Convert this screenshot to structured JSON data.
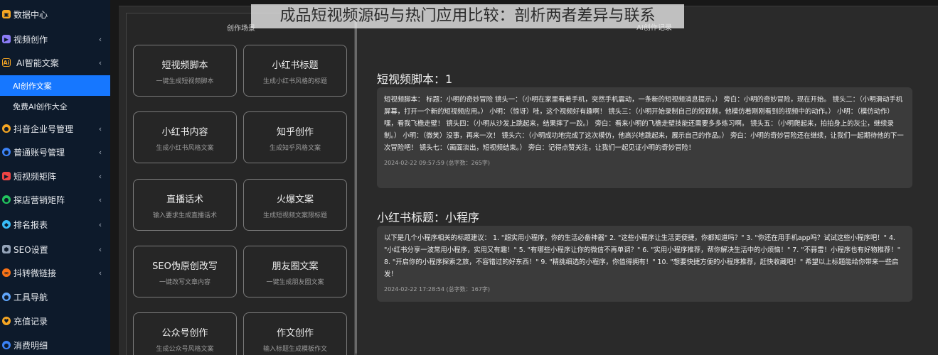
{
  "sidebar": {
    "items": [
      {
        "label": "数据中心",
        "icon": "data-center-icon",
        "color": "#f5a623"
      },
      {
        "label": "视频创作",
        "icon": "video-icon",
        "color": "#8b7cf6",
        "chevron": "‹"
      },
      {
        "label": "AI智能文案",
        "icon": "ai-icon",
        "color": "#f5a623",
        "chevron": "‹"
      },
      {
        "label": "AI创作文案",
        "sub": true,
        "active": true
      },
      {
        "label": "免费AI创作大全",
        "sub": true
      },
      {
        "label": "抖音企业号管理",
        "icon": "douyin-icon",
        "color": "#f5a623",
        "chevron": "‹"
      },
      {
        "label": "普通账号管理",
        "icon": "account-icon",
        "color": "#3b82f6",
        "chevron": "‹"
      },
      {
        "label": "短视频矩阵",
        "icon": "matrix-icon",
        "color": "#ef4444",
        "chevron": "‹"
      },
      {
        "label": "探店营销矩阵",
        "icon": "store-icon",
        "color": "#22c55e",
        "chevron": "‹"
      },
      {
        "label": "排名报表",
        "icon": "report-icon",
        "color": "#38bdf8",
        "chevron": "‹"
      },
      {
        "label": "SEO设置",
        "icon": "seo-icon",
        "color": "#94a3b8",
        "chevron": "‹"
      },
      {
        "label": "抖转微链接",
        "icon": "link-icon",
        "color": "#f97316",
        "chevron": "‹"
      },
      {
        "label": "工具导航",
        "icon": "tools-icon",
        "color": "#60a5fa"
      },
      {
        "label": "充值记录",
        "icon": "recharge-icon",
        "color": "#f5a623"
      },
      {
        "label": "消费明细",
        "icon": "consume-icon",
        "color": "#3b82f6"
      }
    ]
  },
  "watermark": "成品短视频源码与热门应用比较：剖析两者差异与联系",
  "scene": {
    "title": "创作场景",
    "cards": [
      {
        "title": "短视频脚本",
        "sub": "一键生成短视频脚本"
      },
      {
        "title": "小红书标题",
        "sub": "生成小红书风格的标题"
      },
      {
        "title": "小红书内容",
        "sub": "生成小红书风格文案"
      },
      {
        "title": "知乎创作",
        "sub": "生成知乎风格文案"
      },
      {
        "title": "直播话术",
        "sub": "输入要求生成直播话术"
      },
      {
        "title": "火爆文案",
        "sub": "生成短视频文案限标题"
      },
      {
        "title": "SEO伪原创改写",
        "sub": "一键改写文章内容"
      },
      {
        "title": "朋友圈文案",
        "sub": "一键生成朋友圈文案"
      },
      {
        "title": "公众号创作",
        "sub": "生成公众号风格文案"
      },
      {
        "title": "作文创作",
        "sub": "输入标题生成模板作文"
      }
    ]
  },
  "records": {
    "title": "AI创作记录",
    "items": [
      {
        "heading": "短视频脚本：1",
        "body": "短视频脚本： 标题：小明的奇妙冒险 镜头一：（小明在家里看着手机，突然手机震动，一条新的短视频消息提示。） 旁白：小明的奇妙冒险，现在开始。 镜头二：（小明滑动手机屏幕，打开一个新的短视频应用。） 小明：（惊讶）哇，这个视频好有趣啊！ 镜头三：（小明开始录制自己的短视频，他模仿着刚刚看到的视频中的动作。） 小明：（模仿动作）嘿，看我飞檐走壁！ 镜头四：（小明从沙发上跳起来，结果摔了一跤。） 旁白：看来小明的飞檐走壁技能还需要多多练习啊。 镜头五：（小明爬起来，拍拍身上的灰尘，继续录制。） 小明：（微笑）没事，再来一次！ 镜头六：（小明成功地完成了这次模仿，他高兴地跳起来，展示自己的作品。） 旁白：小明的奇妙冒险还在继续，让我们一起期待他的下一次冒险吧！ 镜头七：（画面淡出，短视频结束。） 旁白：记得点赞关注，让我们一起见证小明的奇妙冒险！",
        "meta": "2024-02-22 09:57:59   (总字数：265字)"
      },
      {
        "heading": "小红书标题：小程序",
        "body": "以下是几个小程序相关的标题建议： 1. \"超实用小程序，你的生活必备神器\" 2. \"这些小程序让生活更便捷，你都知道吗？\" 3. \"你还在用手机app吗？试试这些小程序吧！\" 4. \"小红书分享一波常用小程序，实用又有趣！\" 5. \"有哪些小程序让你的微信不再单调？\" 6. \"实用小程序推荐，帮你解决生活中的小烦恼！\" 7. \"不蒜雷！小程序也有好物推荐！\" 8. \"开启你的小程序探索之旅，不容错过的好东西！\" 9. \"精挑细选的小程序，你值得拥有！\" 10. \"想要快捷方便的小程序推荐，赶快收藏吧！\" 希望以上标题能给你带来一些启发！",
        "meta": "2024-02-22 17:28:54   (总字数：167字)"
      }
    ]
  }
}
